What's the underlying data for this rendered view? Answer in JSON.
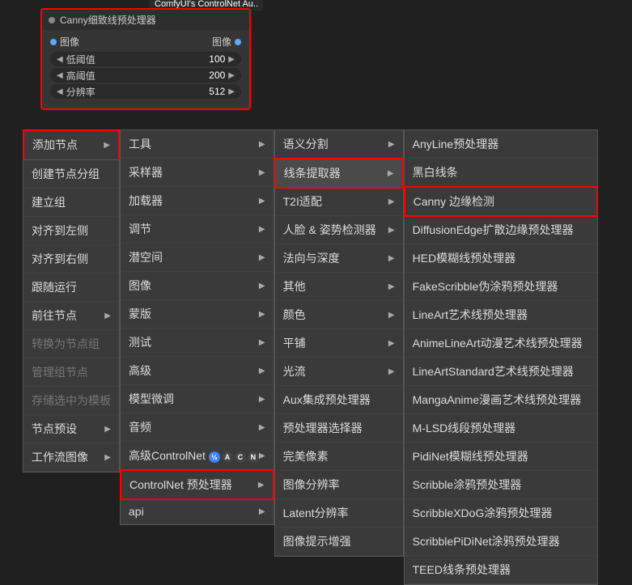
{
  "node": {
    "tab": "ComfyUI's ControlNet Au..",
    "title": "Canny细致线预处理器",
    "input_label": "图像",
    "output_label": "图像",
    "widgets": [
      {
        "label": "低阈值",
        "value": "100"
      },
      {
        "label": "高阈值",
        "value": "200"
      },
      {
        "label": "分辨率",
        "value": "512"
      }
    ]
  },
  "menu1": {
    "highlighted": "添加节点",
    "items": [
      {
        "label": "创建节点分组",
        "has_submenu": false
      },
      {
        "label": "建立组",
        "has_submenu": false
      },
      {
        "label": "对齐到左侧",
        "has_submenu": false
      },
      {
        "label": "对齐到右侧",
        "has_submenu": false
      },
      {
        "label": "跟随运行",
        "has_submenu": false
      },
      {
        "label": "前往节点",
        "has_submenu": true
      },
      {
        "label": "转换为节点组",
        "has_submenu": false,
        "disabled": true
      },
      {
        "label": "管理组节点",
        "has_submenu": false,
        "disabled": true
      },
      {
        "label": "存储选中为模板",
        "has_submenu": false,
        "disabled": true
      },
      {
        "label": "节点预设",
        "has_submenu": true
      },
      {
        "label": "工作流图像",
        "has_submenu": true
      }
    ]
  },
  "menu2": {
    "items": [
      {
        "label": "工具",
        "has_submenu": true
      },
      {
        "label": "采样器",
        "has_submenu": true
      },
      {
        "label": "加载器",
        "has_submenu": true
      },
      {
        "label": "调节",
        "has_submenu": true
      },
      {
        "label": "潜空间",
        "has_submenu": true
      },
      {
        "label": "图像",
        "has_submenu": true
      },
      {
        "label": "蒙版",
        "has_submenu": true
      },
      {
        "label": "测试",
        "has_submenu": true
      },
      {
        "label": "高级",
        "has_submenu": true
      },
      {
        "label": "模型微调",
        "has_submenu": true
      },
      {
        "label": "音频",
        "has_submenu": true
      },
      {
        "label": "高级ControlNet",
        "has_submenu": true,
        "badges": true
      },
      {
        "label": "ControlNet 预处理器",
        "has_submenu": true,
        "highlighted": true
      },
      {
        "label": "api",
        "has_submenu": true
      }
    ]
  },
  "menu3": {
    "items": [
      {
        "label": "语义分割",
        "has_submenu": true
      },
      {
        "label": "线条提取器",
        "has_submenu": true,
        "highlighted": true,
        "hovered": true
      },
      {
        "label": "T2I适配",
        "has_submenu": true
      },
      {
        "label": "人脸 & 姿势检测器",
        "has_submenu": true
      },
      {
        "label": "法向与深度",
        "has_submenu": true
      },
      {
        "label": "其他",
        "has_submenu": true
      },
      {
        "label": "颜色",
        "has_submenu": true
      },
      {
        "label": "平铺",
        "has_submenu": true
      },
      {
        "label": "光流",
        "has_submenu": true
      },
      {
        "label": "Aux集成预处理器",
        "has_submenu": false
      },
      {
        "label": "预处理器选择器",
        "has_submenu": false
      },
      {
        "label": "完美像素",
        "has_submenu": false
      },
      {
        "label": "图像分辨率",
        "has_submenu": false
      },
      {
        "label": "Latent分辨率",
        "has_submenu": false
      },
      {
        "label": "图像提示增强",
        "has_submenu": false
      }
    ]
  },
  "menu4": {
    "items": [
      {
        "label": "AnyLine预处理器"
      },
      {
        "label": "黑白线条"
      },
      {
        "label": "Canny 边缘检测",
        "highlighted": true
      },
      {
        "label": "DiffusionEdge扩散边缘预处理器"
      },
      {
        "label": "HED模糊线预处理器"
      },
      {
        "label": "FakeScribble伪涂鸦预处理器"
      },
      {
        "label": "LineArt艺术线预处理器"
      },
      {
        "label": "AnimeLineArt动漫艺术线预处理器"
      },
      {
        "label": "LineArtStandard艺术线预处理器"
      },
      {
        "label": "MangaAnime漫画艺术线预处理器"
      },
      {
        "label": "M-LSD线段预处理器"
      },
      {
        "label": "PidiNet模糊线预处理器"
      },
      {
        "label": "Scribble涂鸦预处理器"
      },
      {
        "label": "ScribbleXDoG涂鸦预处理器"
      },
      {
        "label": "ScribblePiDiNet涂鸦预处理器"
      },
      {
        "label": "TEED线条预处理器"
      }
    ]
  },
  "badge_chars": [
    "½",
    "A",
    "C",
    "N"
  ]
}
